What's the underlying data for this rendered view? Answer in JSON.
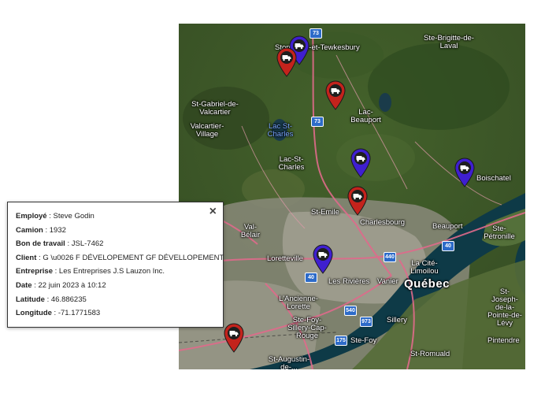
{
  "popup": {
    "close_label": "×",
    "rows": [
      {
        "label": "Employé",
        "value": "Steve Godin"
      },
      {
        "label": "Camion",
        "value": "1932"
      },
      {
        "label": "Bon de travail",
        "value": "JSL-7462"
      },
      {
        "label": "Client",
        "value": "G \\u0026 F DÉVELOPEMENT GF DÉVELLOPEMENT"
      },
      {
        "label": "Entreprise",
        "value": "Les Entreprises J.S Lauzon Inc."
      },
      {
        "label": "Date",
        "value": "22 juin 2023 à 10:12"
      },
      {
        "label": "Latitude",
        "value": "46.886235"
      },
      {
        "label": "Longitude",
        "value": "-71.1771583"
      }
    ]
  },
  "map": {
    "places": {
      "stoneham": "Stoneham-et-Tewkesbury",
      "ste_brigitte": "Ste-Brigitte-de-Laval",
      "st_gabriel": "St-Gabriel-de-Valcartier",
      "valcartier": "Valcartier-Village",
      "lac_beauport": "Lac-Beauport",
      "lac_st_charles_water": "Lac St-Charles",
      "lac_st_charles": "Lac-St-Charles",
      "boischatel": "Boischatel",
      "st_emile": "St-Emile",
      "charlesbourg": "Charlesbourg",
      "beauport": "Beauport",
      "val_belair": "Val-Bélair",
      "loretteville": "Loretteville",
      "ste_petronille": "Ste-Pétronille",
      "la_cite": "La Cité-Limoilou",
      "les_rivieres": "Les Rivières",
      "vanier": "Vanier",
      "quebec": "Québec",
      "ancienne_lorette": "L'Ancienne-Lorette",
      "ste_foy_sillery": "Ste-Foy-Sillery-Cap-Rouge",
      "sillery": "Sillery",
      "ste_foy": "Ste-Foy",
      "st_joseph": "St-Joseph-de-la-Pointe-de-Lévy",
      "pintendre": "Pintendre",
      "st_romuald": "St-Romuald",
      "st_augustin": "St-Augustin-de-..."
    },
    "highways": {
      "a73_north": "73",
      "a73": "73",
      "a40_east": "40",
      "a40_west": "40",
      "a440": "440",
      "a540": "540",
      "a973": "973",
      "a175": "175"
    },
    "marker_colors": {
      "blue": "#3f1fd0",
      "red": "#c3231c"
    },
    "markers": [
      {
        "color": "blue",
        "icon": "truck-icon"
      },
      {
        "color": "red",
        "icon": "truck-icon"
      },
      {
        "color": "red",
        "icon": "truck-icon"
      },
      {
        "color": "blue",
        "icon": "truck-icon"
      },
      {
        "color": "blue",
        "icon": "truck-icon"
      },
      {
        "color": "red",
        "icon": "truck-icon"
      },
      {
        "color": "blue",
        "icon": "truck-icon"
      },
      {
        "color": "red",
        "icon": "truck-icon"
      }
    ]
  }
}
